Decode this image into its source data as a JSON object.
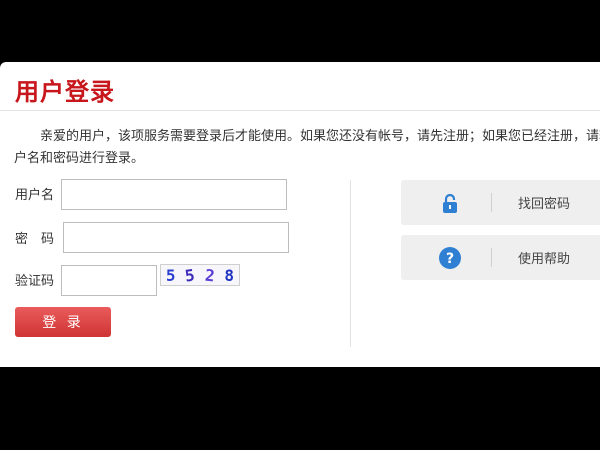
{
  "login": {
    "title": "用户登录",
    "intro": "亲爱的用户，该项服务需要登录后才能使用。如果您还没有帐号，请先注册；如果您已经注册，请输入您的用户名和密码进行登录。",
    "username_label": "用户名",
    "username_value": "",
    "password_label": "密　码",
    "password_value": "",
    "captcha_label": "验证码",
    "captcha_value": "",
    "captcha_digits": [
      "5",
      "5",
      "2",
      "8"
    ],
    "submit_label": "登 录"
  },
  "side": {
    "forgot": {
      "label": "找回密码",
      "icon": "lock-icon",
      "color": "#2f7fd3"
    },
    "help": {
      "label": "使用帮助",
      "icon": "question-icon",
      "color": "#2f7fd3"
    }
  },
  "colors": {
    "title": "#c8161d",
    "button": "#d63a3a",
    "background": "#000000"
  }
}
